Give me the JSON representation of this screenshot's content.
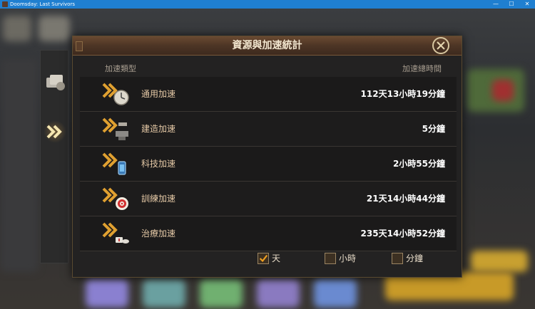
{
  "window": {
    "title": "Doomsday: Last Survivors",
    "minimize": "—",
    "maximize": "☐",
    "close": "✕"
  },
  "dialog": {
    "title": "資源與加速統計",
    "col_type": "加速類型",
    "col_time": "加速總時間",
    "rows": [
      {
        "label": "通用加速",
        "value": "112天13小時19分鐘",
        "icon": "stopwatch-speedup-icon"
      },
      {
        "label": "建造加速",
        "value": "5分鐘",
        "icon": "hammer-anvil-speedup-icon"
      },
      {
        "label": "科技加速",
        "value": "2小時55分鐘",
        "icon": "tech-flask-speedup-icon"
      },
      {
        "label": "訓練加速",
        "value": "21天14小時44分鐘",
        "icon": "target-speedup-icon"
      },
      {
        "label": "治療加速",
        "value": "235天14小時52分鐘",
        "icon": "pill-speedup-icon"
      }
    ],
    "filters": [
      {
        "label": "天",
        "checked": true
      },
      {
        "label": "小時",
        "checked": false
      },
      {
        "label": "分鐘",
        "checked": false
      }
    ]
  },
  "colors": {
    "accent": "#e0a030",
    "title_bar": "#1f7fd0",
    "label": "#e5c9a6"
  }
}
